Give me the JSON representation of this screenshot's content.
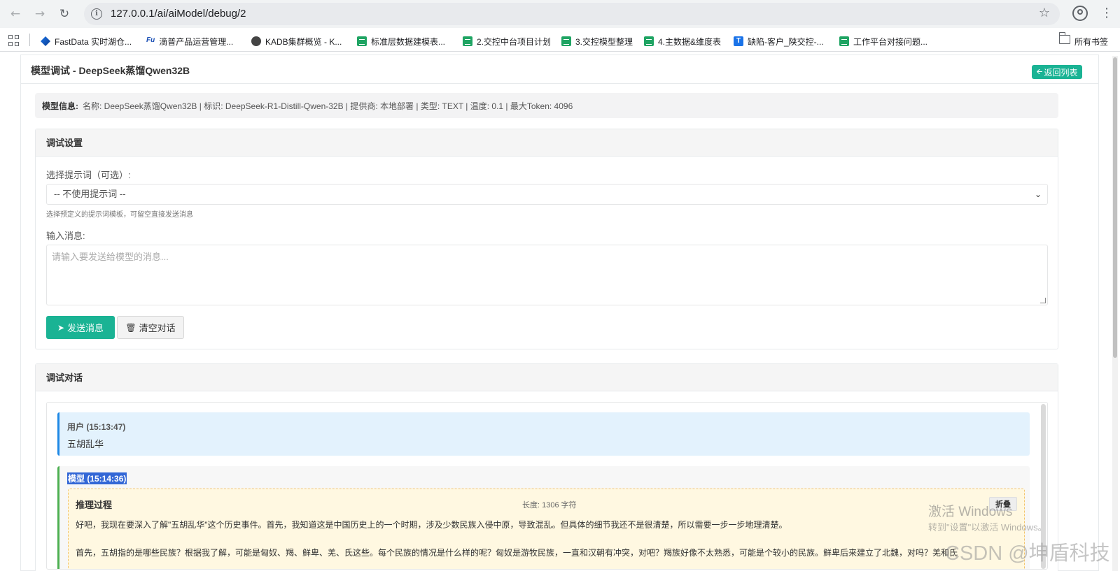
{
  "browser": {
    "url": "127.0.0.1/ai/aiModel/debug/2",
    "bookmarks": [
      {
        "label": "FastData 实时湖仓...",
        "icon": "fastdata-icon"
      },
      {
        "label": "滴普产品运营管理...",
        "icon": "fu-icon"
      },
      {
        "label": "KADB集群概览 - K...",
        "icon": "globe-icon"
      },
      {
        "label": "标准层数据建模表...",
        "icon": "sheet-icon"
      },
      {
        "label": "2.交控中台项目计划",
        "icon": "sheet-icon"
      },
      {
        "label": "3.交控模型整理",
        "icon": "sheet-icon"
      },
      {
        "label": "4.主数据&维度表",
        "icon": "sheet-icon"
      },
      {
        "label": "缺陷-客户_陕交控-...",
        "icon": "t-icon"
      },
      {
        "label": "工作平台对接问题...",
        "icon": "sheet-icon"
      }
    ],
    "all_bookmarks": "所有书签"
  },
  "page": {
    "title": "模型调试 - DeepSeek蒸馏Qwen32B",
    "back_label": "返回列表",
    "model_info_label": "模型信息:",
    "model_info_text": "名称: DeepSeek蒸馏Qwen32B | 标识: DeepSeek-R1-Distill-Qwen-32B | 提供商: 本地部署 | 类型: TEXT | 温度: 0.1 | 最大Token: 4096"
  },
  "settings": {
    "panel_title": "调试设置",
    "prompt_label": "选择提示词（可选）:",
    "prompt_selected": "-- 不使用提示词 --",
    "prompt_hint": "选择预定义的提示词模板，可留空直接发送消息",
    "message_label": "输入消息:",
    "message_placeholder": "请输入要发送给模型的消息...",
    "send_label": "发送消息",
    "clear_label": "清空对话"
  },
  "chat": {
    "panel_title": "调试对话",
    "user_header": "用户 (15:13:47)",
    "user_text": "五胡乱华",
    "model_header": "模型 (15:14:36)",
    "reasoning_title": "推理过程",
    "reasoning_length": "长度: 1306 字符",
    "fold_label": "折叠",
    "reasoning_p1": "好吧，我现在要深入了解\"五胡乱华\"这个历史事件。首先，我知道这是中国历史上的一个时期，涉及少数民族入侵中原，导致混乱。但具体的细节我还不是很清楚，所以需要一步一步地理清楚。",
    "reasoning_p2": "首先，五胡指的是哪些民族？根据我了解，可能是匈奴、羯、鲜卑、羌、氐这些。每个民族的情况是什么样的呢？匈奴是游牧民族，一直和汉朝有冲突，对吧？羯族好像不太熟悉，可能是个较小的民族。鲜卑后来建立了北魏，对吗？羌和氐"
  },
  "watermark": {
    "line1": "激活 Windows",
    "line2": "转到\"设置\"以激活 Windows。",
    "csdn": "CSDN @坤盾科技"
  }
}
